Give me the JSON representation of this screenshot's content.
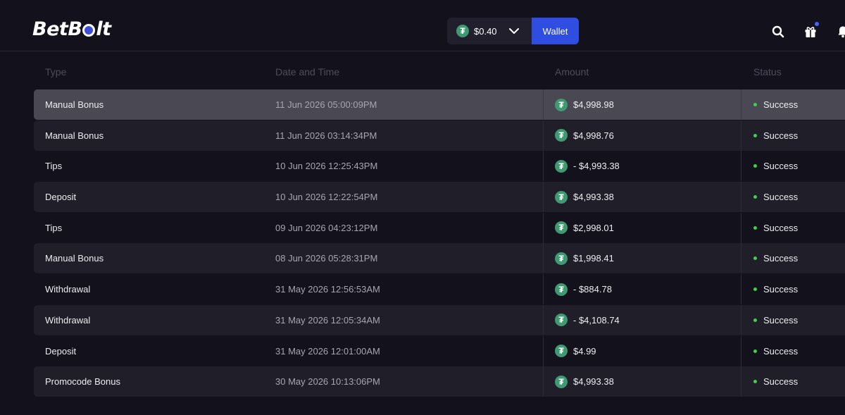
{
  "brand": {
    "name_part1": "Bet",
    "name_part2": "B",
    "name_part3": "lt"
  },
  "header": {
    "balance": "$0.40",
    "wallet_label": "Wallet"
  },
  "icons": {
    "currency": "tether-icon",
    "search": "search-icon",
    "gift": "gift-icon",
    "bell": "bell-icon",
    "chevron": "chevron-down-icon"
  },
  "colors": {
    "accent": "#2f4de0",
    "tether": "#3f9a72",
    "success": "#3ed14a"
  },
  "table": {
    "columns": {
      "type": "Type",
      "date": "Date and Time",
      "amount": "Amount",
      "status": "Status"
    },
    "rows": [
      {
        "type": "Manual Bonus",
        "date": "11 Jun 2026 05:00:09PM",
        "amount": "$4,998.98",
        "status": "Success"
      },
      {
        "type": "Manual Bonus",
        "date": "11 Jun 2026 03:14:34PM",
        "amount": "$4,998.76",
        "status": "Success"
      },
      {
        "type": "Tips",
        "date": "10 Jun 2026 12:25:43PM",
        "amount": "- $4,993.38",
        "status": "Success"
      },
      {
        "type": "Deposit",
        "date": "10 Jun 2026 12:22:54PM",
        "amount": "$4,993.38",
        "status": "Success"
      },
      {
        "type": "Tips",
        "date": "09 Jun 2026 04:23:12PM",
        "amount": "$2,998.01",
        "status": "Success"
      },
      {
        "type": "Manual Bonus",
        "date": "08 Jun 2026 05:28:31PM",
        "amount": "$1,998.41",
        "status": "Success"
      },
      {
        "type": "Withdrawal",
        "date": "31 May 2026 12:56:53AM",
        "amount": "- $884.78",
        "status": "Success"
      },
      {
        "type": "Withdrawal",
        "date": "31 May 2026 12:05:34AM",
        "amount": "- $4,108.74",
        "status": "Success"
      },
      {
        "type": "Deposit",
        "date": "31 May 2026 12:01:00AM",
        "amount": "$4.99",
        "status": "Success"
      },
      {
        "type": "Promocode Bonus",
        "date": "30 May 2026 10:13:06PM",
        "amount": "$4,993.38",
        "status": "Success"
      }
    ]
  }
}
